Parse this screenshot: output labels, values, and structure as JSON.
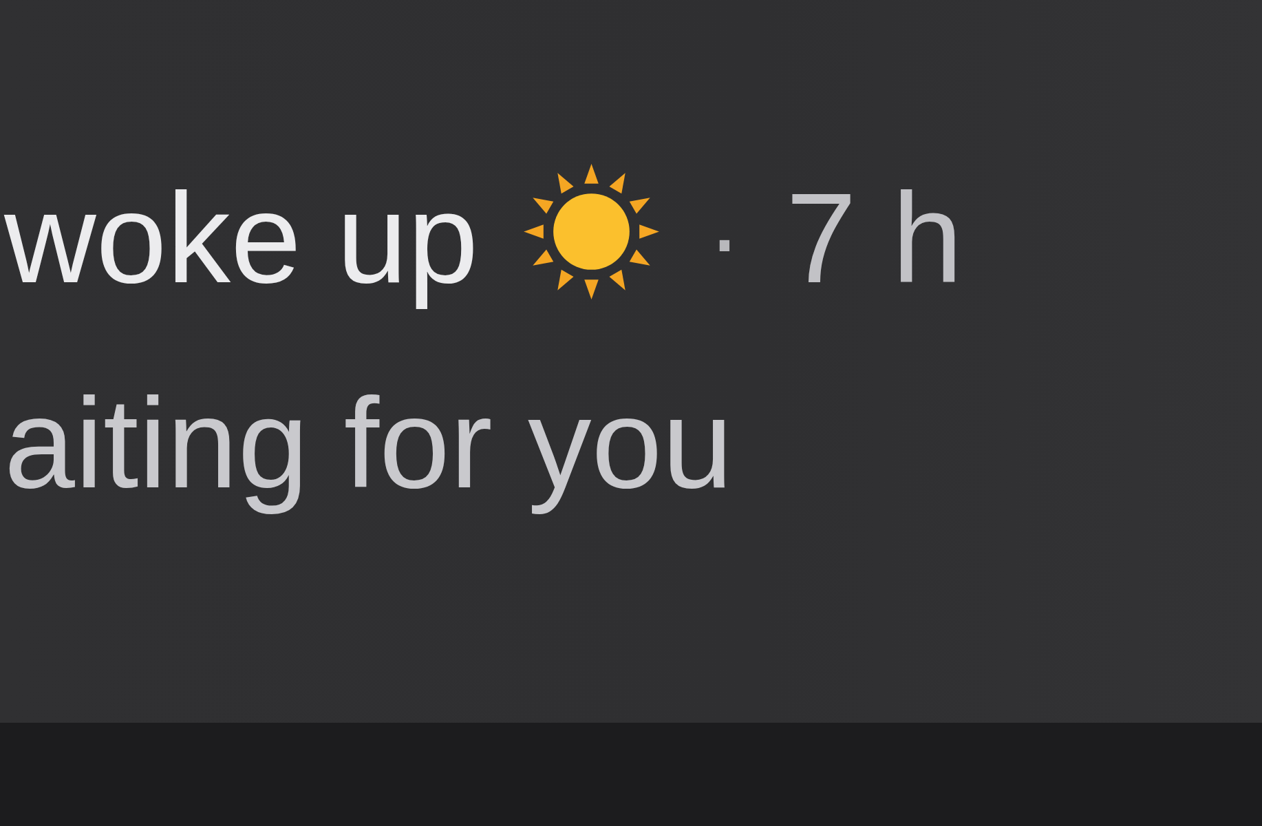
{
  "status_line": {
    "text": "woke up",
    "separator": "·",
    "time": "7 h"
  },
  "message": "aiting for you"
}
